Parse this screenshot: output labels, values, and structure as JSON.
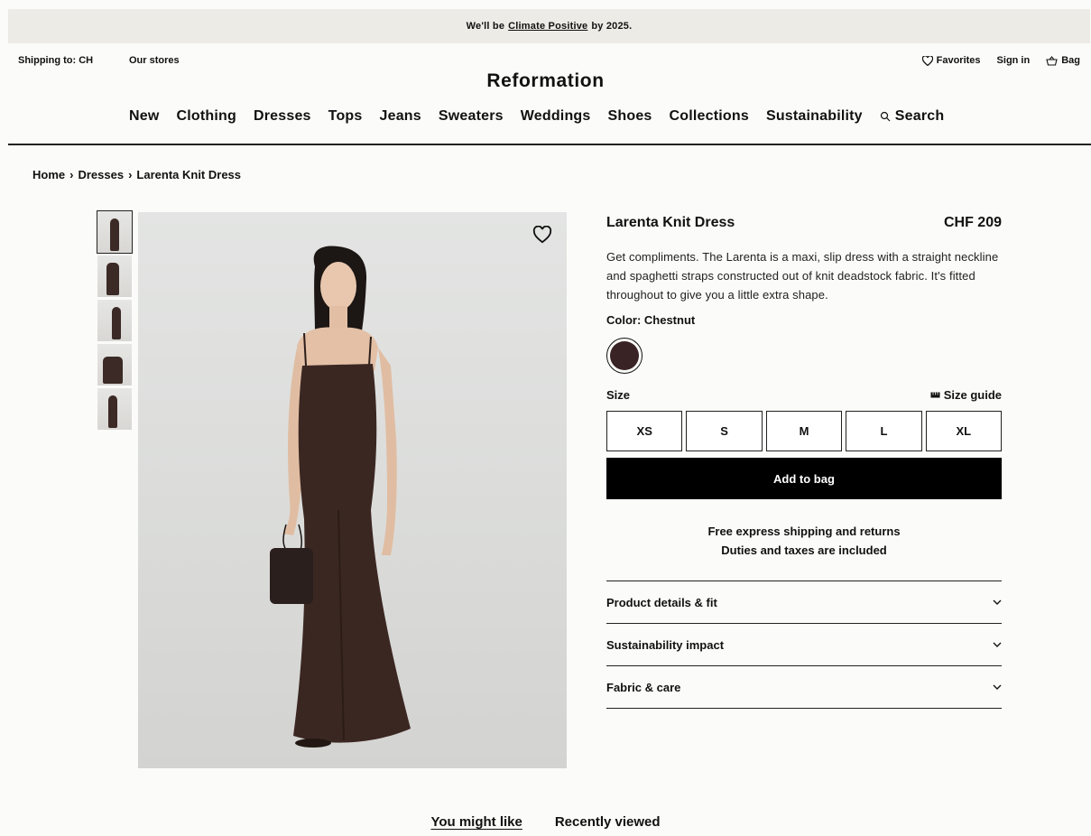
{
  "banner": {
    "prefix": "We'll be",
    "link": "Climate Positive",
    "suffix": "by 2025."
  },
  "topbar": {
    "shipping": "Shipping to: CH",
    "stores": "Our stores",
    "favorites": "Favorites",
    "signin": "Sign in",
    "bag": "Bag"
  },
  "logo": "Reformation",
  "nav": [
    "New",
    "Clothing",
    "Dresses",
    "Tops",
    "Jeans",
    "Sweaters",
    "Weddings",
    "Shoes",
    "Collections",
    "Sustainability"
  ],
  "nav_search": "Search",
  "breadcrumb": [
    "Home",
    "Dresses",
    "Larenta Knit Dress"
  ],
  "product": {
    "name": "Larenta Knit Dress",
    "price": "CHF 209",
    "description": "Get compliments. The Larenta is a maxi, slip dress with a straight neckline and spaghetti straps constructed out of knit deadstock fabric. It's fitted throughout to give you a little extra shape.",
    "color_label": "Color: Chestnut",
    "swatch_color": "#3a2325",
    "size_label": "Size",
    "size_guide": "Size guide",
    "sizes": [
      "XS",
      "S",
      "M",
      "L",
      "XL"
    ],
    "add_to_bag": "Add to bag",
    "shipping_line1": "Free express shipping and returns",
    "shipping_line2": "Duties and taxes are included",
    "accordion": [
      "Product details & fit",
      "Sustainability impact",
      "Fabric & care"
    ]
  },
  "tabs": {
    "you_might_like": "You might like",
    "recently_viewed": "Recently viewed"
  }
}
